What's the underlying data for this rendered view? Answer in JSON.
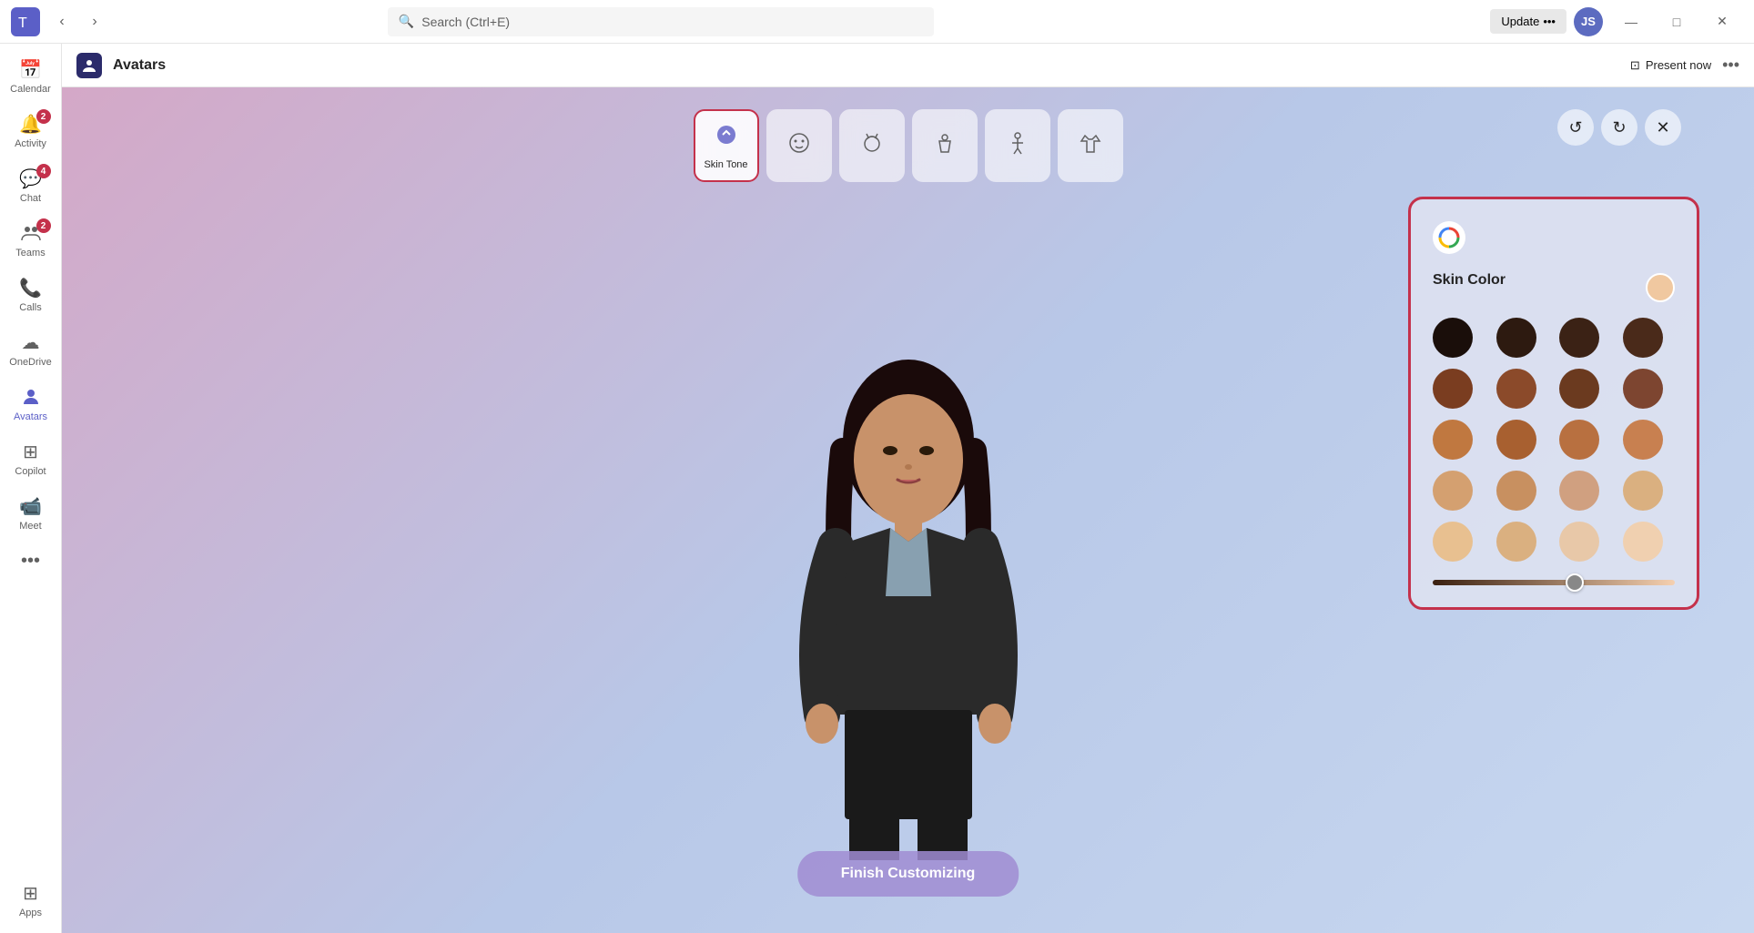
{
  "title_bar": {
    "search_placeholder": "Search (Ctrl+E)",
    "update_label": "Update",
    "update_dots": "•••",
    "nav_back": "‹",
    "nav_forward": "›",
    "minimize": "—",
    "maximize": "□",
    "close": "✕"
  },
  "sidebar": {
    "items": [
      {
        "id": "calendar",
        "label": "Calendar",
        "icon": "📅",
        "badge": null
      },
      {
        "id": "activity",
        "label": "Activity",
        "icon": "🔔",
        "badge": "2"
      },
      {
        "id": "chat",
        "label": "Chat",
        "icon": "💬",
        "badge": "4"
      },
      {
        "id": "teams",
        "label": "Teams",
        "icon": "👥",
        "badge": "2"
      },
      {
        "id": "calls",
        "label": "Calls",
        "icon": "📞",
        "badge": null
      },
      {
        "id": "onedrive",
        "label": "OneDrive",
        "icon": "☁",
        "badge": null
      },
      {
        "id": "avatars",
        "label": "Avatars",
        "icon": "🧑",
        "badge": null,
        "active": true
      },
      {
        "id": "copilot",
        "label": "Copilot",
        "icon": "⊞",
        "badge": null
      },
      {
        "id": "meet",
        "label": "Meet",
        "icon": "📹",
        "badge": null
      },
      {
        "id": "more",
        "label": "•••",
        "icon": "···",
        "badge": null
      },
      {
        "id": "apps",
        "label": "Apps",
        "icon": "⊞",
        "badge": null
      }
    ]
  },
  "app_header": {
    "icon": "🧑",
    "title": "Avatars",
    "present_now": "Present now",
    "more": "•••"
  },
  "toolbar": {
    "items": [
      {
        "id": "skin-tone",
        "label": "Skin Tone",
        "icon": "🎨",
        "active": true
      },
      {
        "id": "face",
        "label": "",
        "icon": "😊",
        "active": false
      },
      {
        "id": "hair",
        "label": "",
        "icon": "💇",
        "active": false
      },
      {
        "id": "body",
        "label": "",
        "icon": "👤",
        "active": false
      },
      {
        "id": "pose",
        "label": "",
        "icon": "🧍",
        "active": false
      },
      {
        "id": "outfit",
        "label": "",
        "icon": "👗",
        "active": false
      }
    ],
    "undo": "↺",
    "redo": "↻",
    "close": "✕"
  },
  "skin_panel": {
    "logo": "🎨",
    "title": "Skin Color",
    "selected_color": "#f5c5a0",
    "colors": [
      {
        "row": 1,
        "swatches": [
          "#1a0e0a",
          "#2d1a10",
          "#3b2215",
          "#4a2a1a"
        ]
      },
      {
        "row": 2,
        "swatches": [
          "#7a3d20",
          "#8b4a2a",
          "#6b3a1f",
          "#7d4530"
        ]
      },
      {
        "row": 3,
        "swatches": [
          "#c07840",
          "#a86030",
          "#b87040",
          "#c08050"
        ]
      },
      {
        "row": 4,
        "swatches": [
          "#d4a070",
          "#c89060",
          "#d0a080",
          "#dab080"
        ]
      },
      {
        "row": 5,
        "swatches": [
          "#e8c090",
          "#dab080",
          "#e0b890",
          "#ecc898"
        ]
      }
    ]
  },
  "finish_btn": {
    "label": "Finish Customizing"
  }
}
